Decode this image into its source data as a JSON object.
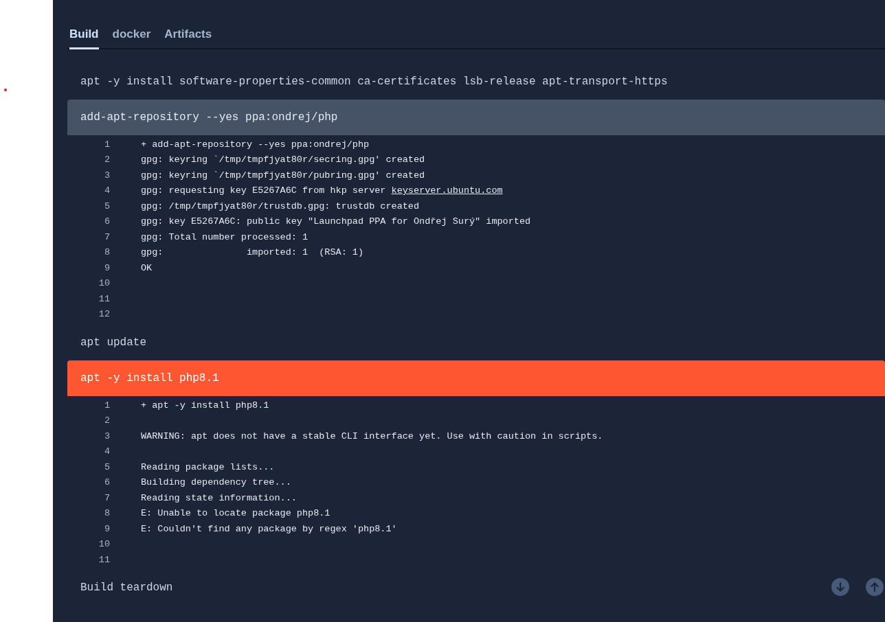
{
  "tabs": [
    {
      "label": "Build",
      "selected": true
    },
    {
      "label": "docker",
      "selected": false
    },
    {
      "label": "Artifacts",
      "selected": false
    }
  ],
  "steps": [
    {
      "kind": "plain",
      "command": "apt -y install software-properties-common ca-certificates lsb-release apt-transport-https"
    },
    {
      "kind": "expanded",
      "command": "add-apt-repository --yes ppa:ondrej/php",
      "log": [
        {
          "number": "1",
          "text": "+ add-apt-repository --yes ppa:ondrej/php"
        },
        {
          "number": "2",
          "text": "gpg: keyring `/tmp/tmpfjyat80r/secring.gpg' created"
        },
        {
          "number": "3",
          "text": "gpg: keyring `/tmp/tmpfjyat80r/pubring.gpg' created"
        },
        {
          "number": "4",
          "text": "gpg: requesting key E5267A6C from hkp server ",
          "link": "keyserver.ubuntu.com"
        },
        {
          "number": "5",
          "text": "gpg: /tmp/tmpfjyat80r/trustdb.gpg: trustdb created"
        },
        {
          "number": "6",
          "text": "gpg: key E5267A6C: public key \"Launchpad PPA for Ondřej Surý\" imported"
        },
        {
          "number": "7",
          "text": "gpg: Total number processed: 1"
        },
        {
          "number": "8",
          "text": "gpg:               imported: 1  (RSA: 1)"
        },
        {
          "number": "9",
          "text": "OK"
        },
        {
          "number": "10"
        },
        {
          "number": "11"
        },
        {
          "number": "12"
        }
      ]
    },
    {
      "kind": "plain",
      "command": "apt update"
    },
    {
      "kind": "failed",
      "command": "apt -y install php8.1",
      "log": [
        {
          "number": "1",
          "text": "+ apt -y install php8.1"
        },
        {
          "number": "2"
        },
        {
          "number": "3",
          "text": "WARNING: apt does not have a stable CLI interface yet. Use with caution in scripts."
        },
        {
          "number": "4"
        },
        {
          "number": "5",
          "text": "Reading package lists..."
        },
        {
          "number": "6",
          "text": "Building dependency tree..."
        },
        {
          "number": "7",
          "text": "Reading state information..."
        },
        {
          "number": "8",
          "text": "E: Unable to locate package php8.1"
        },
        {
          "number": "9",
          "text": "E: Couldn't find any package by regex 'php8.1'"
        },
        {
          "number": "10"
        },
        {
          "number": "11"
        }
      ]
    },
    {
      "kind": "plain",
      "command": "Build teardown"
    }
  ]
}
